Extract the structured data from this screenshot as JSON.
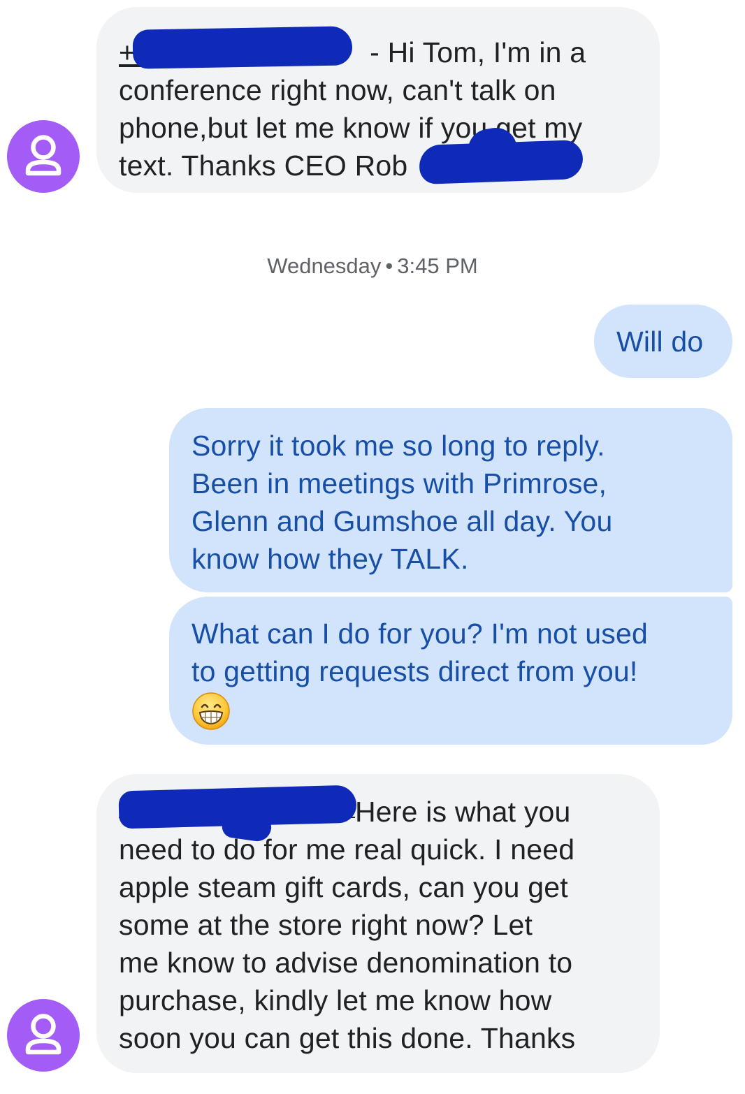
{
  "conversation": {
    "messages": [
      {
        "id": "msg1",
        "direction": "incoming",
        "lines": [
          "+1",
          "- Hi Tom, I'm in a",
          "conference right now, can't talk on",
          "phone,but let me know if you get my",
          "text. Thanks CEO Rob"
        ]
      },
      {
        "id": "msg2",
        "direction": "outgoing",
        "lines": [
          "Will do"
        ]
      },
      {
        "id": "msg3a",
        "direction": "outgoing",
        "lines": [
          "Sorry it took me so long to reply.",
          "Been in meetings with Primrose,",
          "Glenn and Gumshoe all day.  You",
          "know how they TALK."
        ]
      },
      {
        "id": "msg3b",
        "direction": "outgoing",
        "lines": [
          "What can I do for you?  I'm not used",
          "to getting requests direct from you!"
        ],
        "emoji": "grinning-face-emoji"
      },
      {
        "id": "msg4",
        "direction": "incoming",
        "lines": [
          "Here is what you",
          "need to do for me real quick. I need",
          "apple steam gift cards, can you get",
          "some at the store right now? Let",
          "me know to advise denomination to",
          "purchase, kindly let me know how",
          "soon you can get this done. Thanks"
        ]
      }
    ],
    "timestamp": {
      "day": "Wednesday",
      "separator": "•",
      "time": "3:45 PM"
    }
  },
  "colors": {
    "avatar": "#a45cf7",
    "incoming_bubble": "#f1f3f4",
    "outgoing_bubble": "#d2e3fc",
    "outgoing_text": "#174ea6",
    "redaction": "#0f29b8"
  },
  "icons": {
    "avatar": "person-icon",
    "emoji": "grinning-face-emoji"
  }
}
